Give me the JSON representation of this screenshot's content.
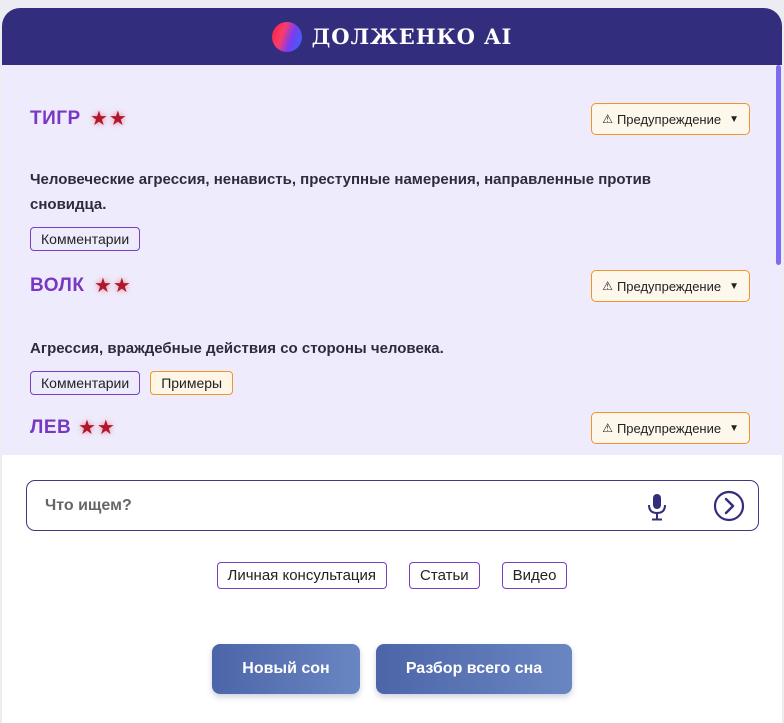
{
  "header": {
    "brand": "ДОЛЖЕНКО AI"
  },
  "results": [
    {
      "name": "ТИГР",
      "stars": "★★",
      "warning_label": "Предупреждение",
      "warning_icon": "⚠",
      "description": "Человеческие агрессия, ненависть, преступные намерения, направленные против сновидца.",
      "tags": [
        "Комментарии"
      ]
    },
    {
      "name": "ВОЛК",
      "stars": "★★",
      "warning_label": "Предупреждение",
      "warning_icon": "⚠",
      "description": "Агрессия, враждебные действия со стороны человека.",
      "tags": [
        "Комментарии",
        "Примеры"
      ]
    },
    {
      "name": "ЛЕВ",
      "stars": "★★",
      "warning_label": "Предупреждение",
      "warning_icon": "⚠"
    }
  ],
  "search": {
    "placeholder": "Что ищем?"
  },
  "links": [
    "Личная консультация",
    "Статьи",
    "Видео"
  ],
  "actions": {
    "new_dream": "Новый сон",
    "full_analysis": "Разбор всего сна"
  },
  "colors": {
    "header_bg": "#332d7d",
    "symbol_name": "#7838c4",
    "star": "#b0172b",
    "warning_border": "#f0932a",
    "accent_button": "#5a74b4"
  }
}
